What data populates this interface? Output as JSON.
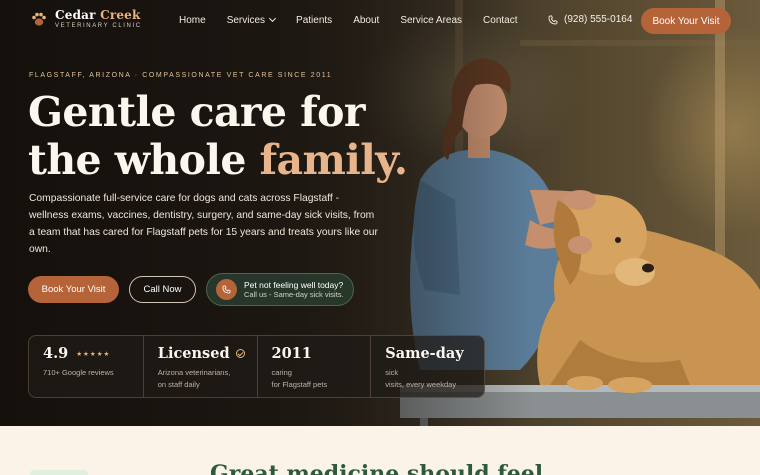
{
  "brand": {
    "name_part1": "Cedar",
    "name_part2": "Creek",
    "tagline": "VETERINARY CLINIC",
    "logo_icon": "paw-icon"
  },
  "nav": {
    "links": [
      "Home",
      "Services",
      "Patients",
      "About",
      "Service Areas",
      "Contact"
    ],
    "phone": "(928) 555-0164",
    "phone_icon": "phone-icon",
    "cta": "Book Your Visit"
  },
  "hero": {
    "eyebrow": "FLAGSTAFF, ARIZONA · COMPASSIONATE VET CARE SINCE 2011",
    "headline_line1": "Gentle care for",
    "headline_line2_plain": "the whole",
    "headline_line2_accent": "family.",
    "lede": "Compassionate full-service care for dogs and cats across Flagstaff - wellness exams, vaccines, dentistry, surgery, and same-day sick visits, from a team that has cared for Flagstaff pets for 15 years and treats yours like our own.",
    "primary_cta": "Book Your Visit",
    "secondary_cta": "Call Now",
    "sick_title": "Pet not feeling well today?",
    "sick_sub": "Call us - Same-day sick visits."
  },
  "stats": [
    {
      "value": "4.9",
      "stars": "★★★★★",
      "caption_line1": "710+ Google reviews",
      "caption_line2": ""
    },
    {
      "value": "Licensed",
      "caption_line1": "Arizona veterinarians,",
      "caption_line2": "on staff daily"
    },
    {
      "value": "2011",
      "caption_line1": "caring",
      "caption_line2": "for Flagstaff pets"
    },
    {
      "value": "Same-day",
      "caption_line1": "sick",
      "caption_line2": "visits, every weekday"
    }
  ],
  "next_section": {
    "title": "Great medicine should feel"
  },
  "colors": {
    "accent": "#b5643a",
    "highlight": "#e8b48b",
    "green": "#2d5a3d",
    "cream": "#fbf3e7"
  }
}
